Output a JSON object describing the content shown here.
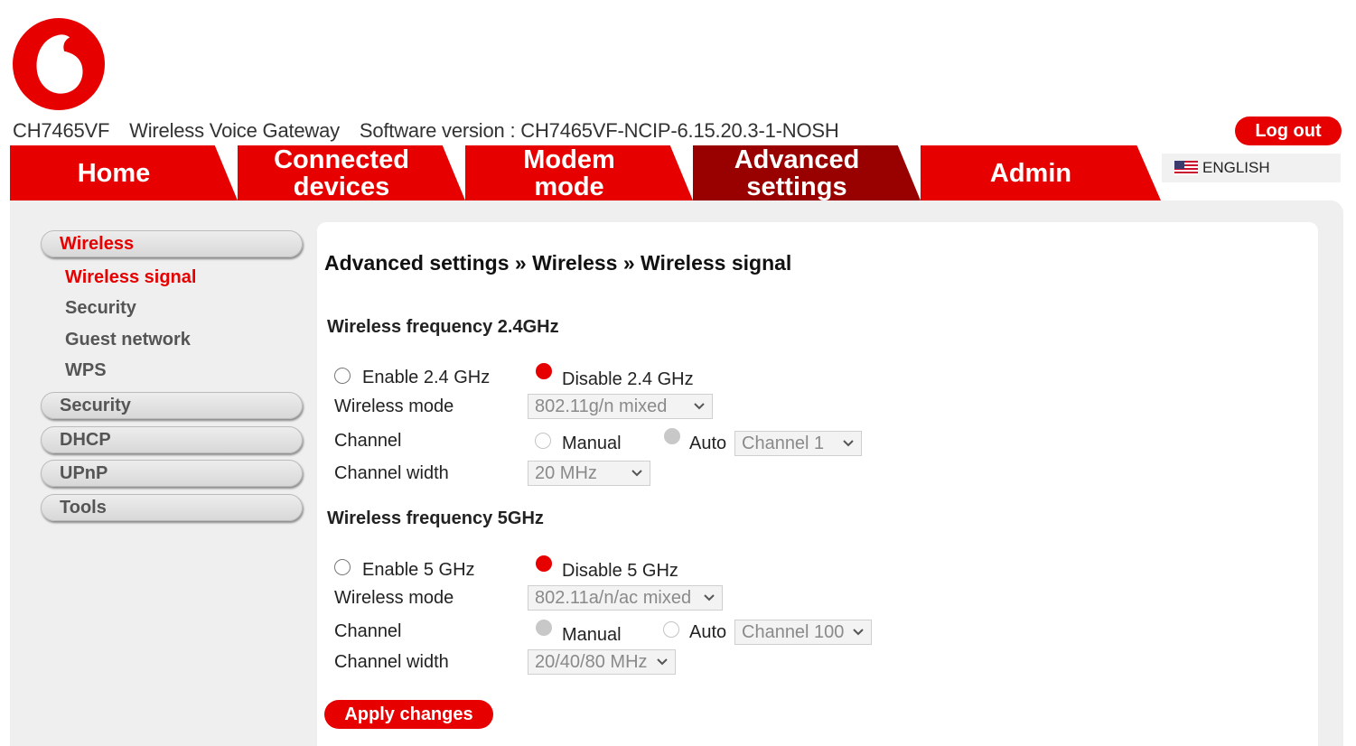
{
  "header": {
    "model": "CH7465VF",
    "product": "Wireless Voice Gateway",
    "software": "Software version : CH7465VF-NCIP-6.15.20.3-1-NOSH",
    "logout_label": "Log out",
    "language": "ENGLISH"
  },
  "tabs": [
    {
      "line1": "Home",
      "line2": ""
    },
    {
      "line1": "Connected",
      "line2": "devices"
    },
    {
      "line1": "Modem",
      "line2": "mode"
    },
    {
      "line1": "Advanced",
      "line2": "settings"
    },
    {
      "line1": "Admin",
      "line2": ""
    }
  ],
  "sidebar": {
    "wireless": "Wireless",
    "sub": [
      "Wireless signal",
      "Security",
      "Guest network",
      "WPS"
    ],
    "security": "Security",
    "dhcp": "DHCP",
    "upnp": "UPnP",
    "tools": "Tools"
  },
  "breadcrumb": "Advanced settings »  Wireless »  Wireless signal",
  "band24": {
    "title": "Wireless frequency 2.4GHz",
    "enable_label": "Enable 2.4 GHz",
    "disable_label": "Disable 2.4 GHz",
    "mode_label": "Wireless mode",
    "mode_value": "802.11g/n mixed",
    "channel_label": "Channel",
    "manual_label": "Manual",
    "auto_label": "Auto",
    "channel_value": "Channel 1",
    "width_label": "Channel width",
    "width_value": "20 MHz"
  },
  "band5": {
    "title": "Wireless frequency 5GHz",
    "enable_label": "Enable 5 GHz",
    "disable_label": "Disable 5 GHz",
    "mode_label": "Wireless mode",
    "mode_value": "802.11a/n/ac mixed",
    "channel_label": "Channel",
    "manual_label": "Manual",
    "auto_label": "Auto",
    "channel_value": "Channel 100",
    "width_label": "Channel width",
    "width_value": "20/40/80 MHz"
  },
  "apply_label": "Apply changes",
  "colors": {
    "brand": "#e60000",
    "active_tab": "#990000"
  }
}
